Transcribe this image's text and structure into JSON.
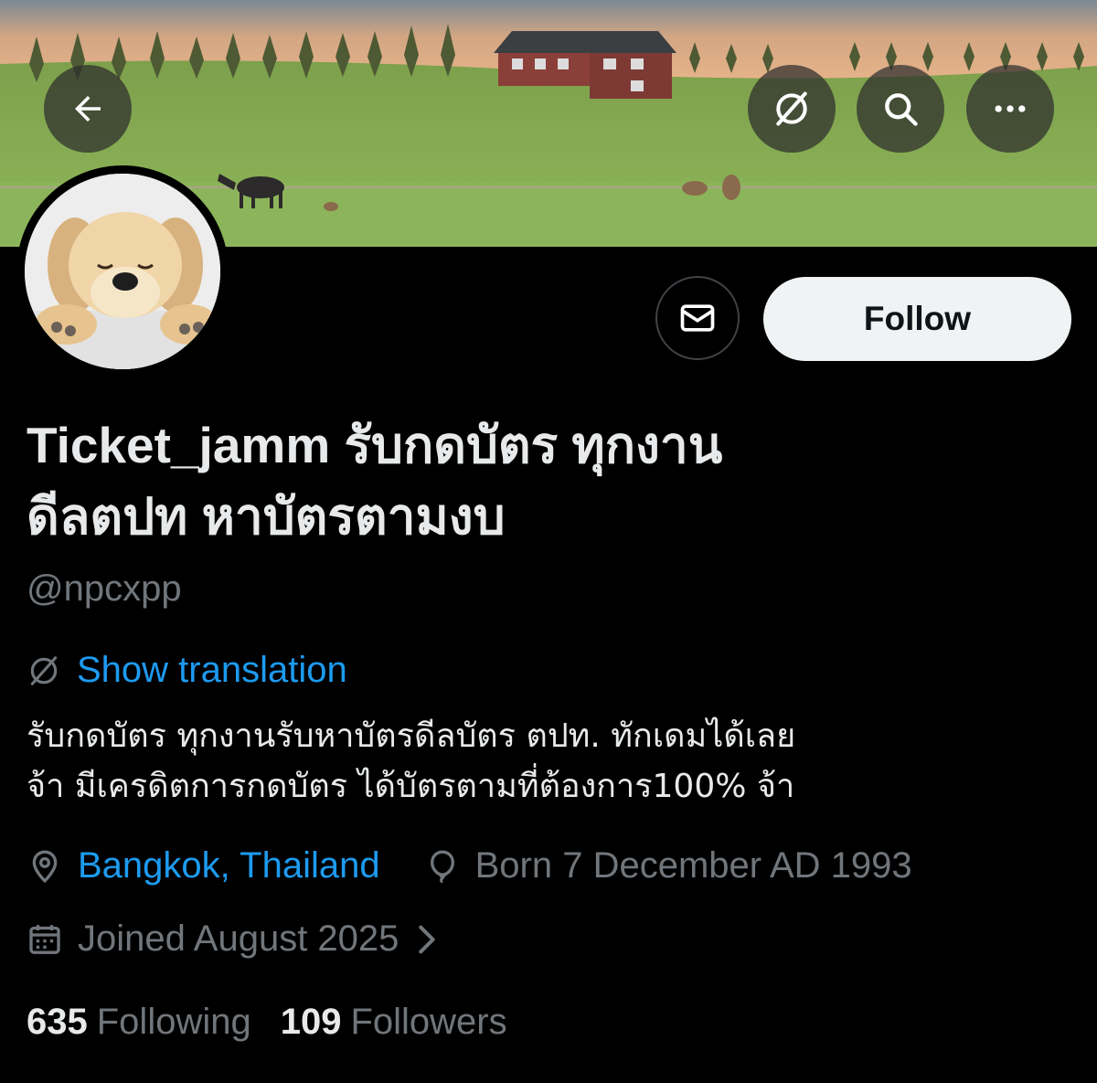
{
  "header": {
    "back_icon": "arrow-left-icon",
    "translate_icon": "translate-globe-icon",
    "search_icon": "search-icon",
    "more_icon": "more-horizontal-icon"
  },
  "actions": {
    "message_icon": "envelope-icon",
    "follow_label": "Follow"
  },
  "profile": {
    "display_name_line1": "Ticket_jamm รับกดบัตร ทุกงาน",
    "display_name_line2": "ดีลตปท หาบัตรตามงบ",
    "handle": "@npcxpp",
    "show_translation": "Show translation",
    "bio_line1": "รับกดบัตร ทุกงานรับหาบัตรดีลบัตร ตปท. ทักเดมได้เลย",
    "bio_line2": "จ้า มีเครดิตการกดบัตร ได้บัตรตามที่ต้องการ100% จ้า",
    "location": "Bangkok, Thailand",
    "birthday": "Born 7 December AD 1993",
    "joined": "Joined August 2025"
  },
  "stats": {
    "following_count": "635",
    "following_label": "Following",
    "followers_count": "109",
    "followers_label": "Followers"
  },
  "colors": {
    "background": "#000000",
    "text_primary": "#e7e9ea",
    "text_secondary": "#71767b",
    "link": "#1d9bf0",
    "follow_bg": "#eff3f4"
  }
}
